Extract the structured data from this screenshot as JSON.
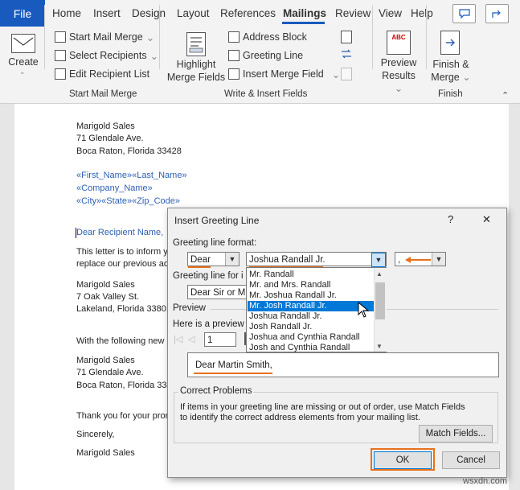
{
  "tabs": {
    "file": "File",
    "home": "Home",
    "insert": "Insert",
    "design": "Design",
    "layout": "Layout",
    "references": "References",
    "mailings": "Mailings",
    "review": "Review",
    "view": "View",
    "help": "Help"
  },
  "ribbon": {
    "create": "Create",
    "start_mail_merge": "Start Mail Merge",
    "select_recipients": "Select Recipients",
    "edit_recipient_list": "Edit Recipient List",
    "group_start": "Start Mail Merge",
    "highlight_line1": "Highlight",
    "highlight_line2": "Merge Fields",
    "address_block": "Address Block",
    "greeting_line": "Greeting Line",
    "insert_merge_field": "Insert Merge Field",
    "group_write": "Write & Insert Fields",
    "preview_line1": "Preview",
    "preview_line2": "Results",
    "abc": "ABC",
    "finish_line1": "Finish &",
    "finish_line2": "Merge",
    "group_finish": "Finish"
  },
  "doc": {
    "s1": "Marigold Sales",
    "s2": "71 Glendale Ave.",
    "s3": "Boca Raton, Florida 33428",
    "f1": "«First_Name»«Last_Name»",
    "f2": "«Company_Name»",
    "f3": "«City»«State»«Zip_Code»",
    "dear": "Dear Recipient Name,",
    "p1": "This letter is to inform y",
    "p2": "replace our previous ad",
    "m1": "Marigold Sales",
    "m2": "7 Oak Valley St.",
    "m3": "Lakeland, Florida 33801",
    "w1": "With the following new",
    "b1": "Marigold Sales",
    "b2": "71 Glendale Ave.",
    "b3": "Boca Raton, Florida 33428",
    "t1": "Thank you for your pror",
    "t2": "Sincerely,",
    "t3": "Marigold Sales"
  },
  "dialog": {
    "title": "Insert Greeting Line",
    "help": "?",
    "close": "✕",
    "format_label": "Greeting line format:",
    "salutation": "Dear",
    "name_format": "Joshua Randall Jr.",
    "punctuation": ",",
    "invalid_label": "Greeting line for i",
    "invalid_value": "Dear Sir or Ma",
    "preview_label": "Preview",
    "preview_here": "Here is a preview f",
    "record_number": "1",
    "preview_text": "Dear Martin Smith,",
    "correct_label": "Correct Problems",
    "correct_text1": "If items in your greeting line are missing or out of order, use Match Fields",
    "correct_text2": "to identify the correct address elements from your mailing list.",
    "match_fields": "Match Fields...",
    "ok": "OK",
    "cancel": "Cancel",
    "name_options": [
      "Mr. Randall",
      "Mr. and Mrs. Randall",
      "Mr. Joshua Randall Jr.",
      "Mr. Josh Randall Jr.",
      "Joshua Randall Jr.",
      "Josh Randall Jr.",
      "Joshua and Cynthia Randall",
      "Josh and Cynthia Randall"
    ],
    "selected_index": 3
  },
  "watermark": "wsxdn.com",
  "colors": {
    "accent": "#185abd",
    "highlight": "#e8711c",
    "selection": "#0078d7",
    "merge_field": "#2e60b4"
  }
}
